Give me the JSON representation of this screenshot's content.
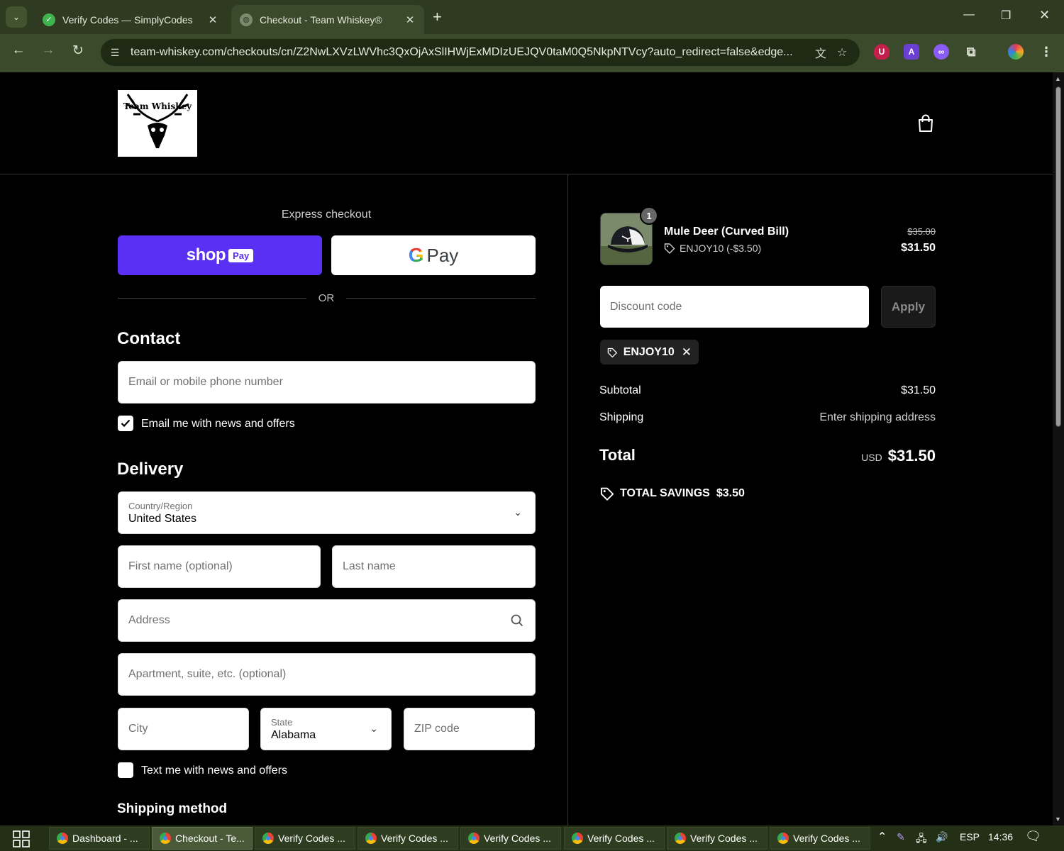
{
  "browser": {
    "tabs": [
      {
        "title": "Verify Codes — SimplyCodes",
        "active": false
      },
      {
        "title": "Checkout - Team Whiskey®",
        "active": true
      }
    ],
    "url": "team-whiskey.com/checkouts/cn/Z2NwLXVzLWVhc3QxOjAxSlIHWjExMDIzUEJQV0taM0Q5NkpNTVcy?auto_redirect=false&edge...",
    "extensions": [
      {
        "name": "ublock-icon",
        "letter": "U",
        "color": "#c21f4a"
      },
      {
        "name": "a-extension-icon",
        "letter": "A",
        "color": "#6b3fd4"
      },
      {
        "name": "link-extension-icon",
        "letter": "∞",
        "color": "#8a5cf6"
      }
    ]
  },
  "store": {
    "logo_text": "Team Whiskey"
  },
  "express": {
    "label": "Express checkout",
    "shop_pay_label": "shop",
    "shop_pay_badge": "Pay",
    "gpay_label": "Pay",
    "or_label": "OR"
  },
  "contact": {
    "heading": "Contact",
    "email_placeholder": "Email or mobile phone number",
    "news_label": "Email me with news and offers",
    "news_checked": true
  },
  "delivery": {
    "heading": "Delivery",
    "country_label": "Country/Region",
    "country_value": "United States",
    "first_name_placeholder": "First name (optional)",
    "last_name_placeholder": "Last name",
    "address_placeholder": "Address",
    "apartment_placeholder": "Apartment, suite, etc. (optional)",
    "city_placeholder": "City",
    "state_label": "State",
    "state_value": "Alabama",
    "zip_placeholder": "ZIP code",
    "text_news_label": "Text me with news and offers",
    "text_news_checked": false
  },
  "shipping_method": {
    "heading": "Shipping method"
  },
  "summary": {
    "item": {
      "quantity": "1",
      "name": "Mule Deer (Curved Bill)",
      "discount": "ENJOY10 (-$3.50)",
      "original_price": "$35.00",
      "price": "$31.50"
    },
    "discount_placeholder": "Discount code",
    "apply_label": "Apply",
    "applied_code": "ENJOY10",
    "subtotal_label": "Subtotal",
    "subtotal_value": "$31.50",
    "shipping_label": "Shipping",
    "shipping_value": "Enter shipping address",
    "total_label": "Total",
    "currency": "USD",
    "total_value": "$31.50",
    "savings_label": "TOTAL SAVINGS",
    "savings_value": "$3.50"
  },
  "taskbar": {
    "items": [
      {
        "label": "Dashboard - ...",
        "active": false
      },
      {
        "label": "Checkout - Te...",
        "active": true
      },
      {
        "label": "Verify Codes ...",
        "active": false
      },
      {
        "label": "Verify Codes ...",
        "active": false
      },
      {
        "label": "Verify Codes ...",
        "active": false
      },
      {
        "label": "Verify Codes ...",
        "active": false
      },
      {
        "label": "Verify Codes ...",
        "active": false
      },
      {
        "label": "Verify Codes ...",
        "active": false
      }
    ],
    "language": "ESP",
    "time": "14:36"
  },
  "colors": {
    "shop_pay": "#5a31f4",
    "chrome": "#3b4a2a",
    "page_bg": "#000000"
  }
}
